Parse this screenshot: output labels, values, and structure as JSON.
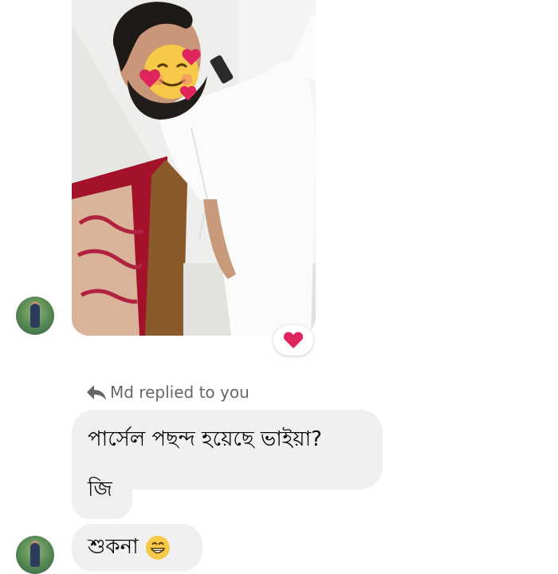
{
  "message_photo": {
    "reaction_icon": "heart-icon",
    "reaction_color": "#e0245e"
  },
  "reply_context": {
    "icon": "reply-arrow-icon",
    "label": "Md replied to you"
  },
  "messages": [
    {
      "text": "পার্সেল পছন্দ হয়েছে ভাইয়া?"
    },
    {
      "text": "জি"
    },
    {
      "text": "শুকনা",
      "emoji": "grinning-face-icon"
    }
  ],
  "colors": {
    "bubble_bg": "#f0f0f3",
    "meta_text": "#65676b",
    "heart": "#e0245e"
  }
}
